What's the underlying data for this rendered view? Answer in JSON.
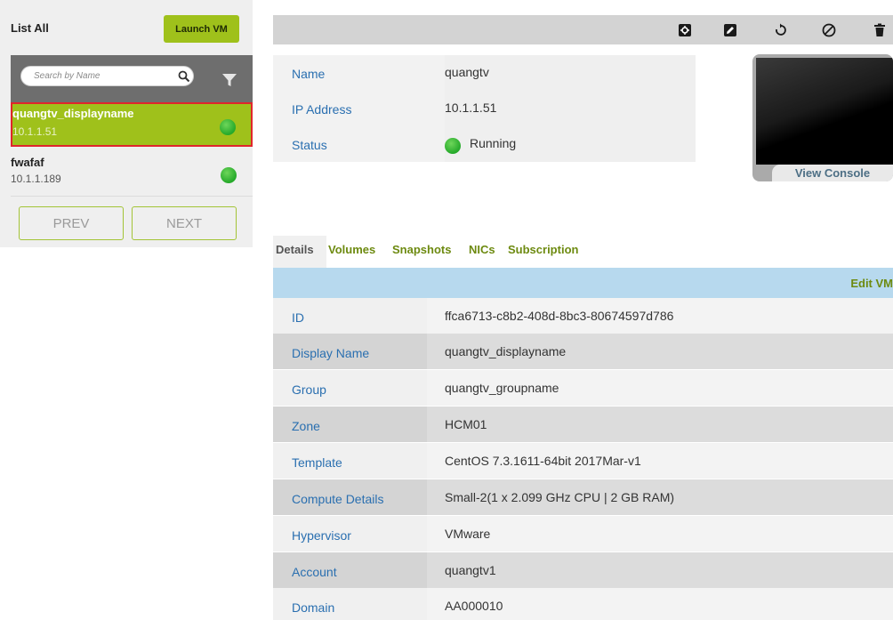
{
  "sidebar": {
    "list_all": "List All",
    "launch_vm": "Launch VM",
    "search_placeholder": "Search by Name",
    "vms": [
      {
        "name": "quangtv_displayname",
        "ip": "10.1.1.51",
        "selected": true,
        "status_color": "#25a92a"
      },
      {
        "name": "fwafaf",
        "ip": "10.1.1.189",
        "selected": false,
        "status_color": "#25a92a"
      }
    ],
    "prev": "PREV",
    "next": "NEXT"
  },
  "toolbar": {
    "icons": [
      "console-icon",
      "edit-icon",
      "reboot-icon",
      "stop-icon",
      "delete-icon"
    ]
  },
  "summary": {
    "name_label": "Name",
    "name_value": "quangtv",
    "ip_label": "IP Address",
    "ip_value": "10.1.1.51",
    "status_label": "Status",
    "status_value": "Running"
  },
  "console": {
    "view_console": "View Console"
  },
  "tabs": [
    "Details",
    "Volumes",
    "Snapshots",
    "NICs",
    "Subscription"
  ],
  "details": {
    "edit_vm": "Edit VM",
    "rows": [
      {
        "label": "ID",
        "value": "ffca6713-c8b2-408d-8bc3-80674597d786"
      },
      {
        "label": "Display Name",
        "value": "quangtv_displayname"
      },
      {
        "label": "Group",
        "value": "quangtv_groupname"
      },
      {
        "label": "Zone",
        "value": "HCM01"
      },
      {
        "label": "Template",
        "value": "CentOS 7.3.1611-64bit 2017Mar-v1"
      },
      {
        "label": "Compute Details",
        "value": "Small-2(1 x 2.099 GHz CPU | 2 GB RAM)"
      },
      {
        "label": "Hypervisor",
        "value": "VMware"
      },
      {
        "label": "Account",
        "value": "quangtv1"
      },
      {
        "label": "Domain",
        "value": "AA000010"
      }
    ]
  },
  "colors": {
    "accent_green": "#9fc11b",
    "label_blue": "#2a6fb0",
    "header_blue": "#b7d9ee",
    "running_green": "#25a92a",
    "selected_border": "#e0262b"
  }
}
